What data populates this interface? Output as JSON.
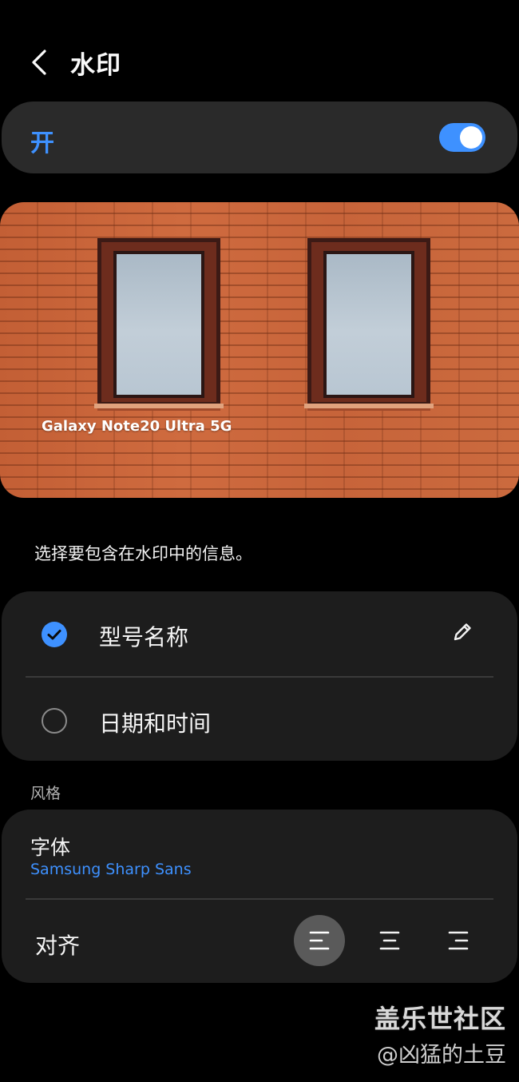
{
  "header": {
    "title": "水印",
    "back_icon": "chevron-left-icon"
  },
  "master_switch": {
    "label": "开",
    "enabled": true,
    "accent": "#3e91ff"
  },
  "preview": {
    "watermark_text": "Galaxy Note20 Ultra 5G"
  },
  "description": "选择要包含在水印中的信息。",
  "options": [
    {
      "label": "型号名称",
      "checked": true,
      "editable": true
    },
    {
      "label": "日期和时间",
      "checked": false,
      "editable": false
    }
  ],
  "style": {
    "section_title": "风格",
    "font": {
      "label": "字体",
      "value": "Samsung Sharp Sans"
    },
    "alignment": {
      "label": "对齐",
      "options": [
        "left",
        "center",
        "right"
      ],
      "selected": "left"
    }
  },
  "overlay": {
    "brand": "盖乐世社区",
    "author": "@凶猛的土豆"
  }
}
